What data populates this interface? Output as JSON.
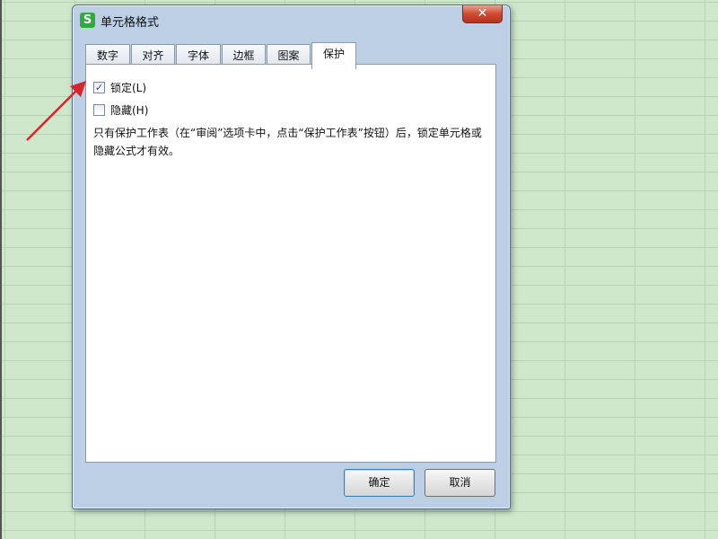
{
  "dialog": {
    "title": "单元格格式",
    "app_icon_letter": "S",
    "close_glyph": "✕",
    "tabs": [
      {
        "label": "数字"
      },
      {
        "label": "对齐"
      },
      {
        "label": "字体"
      },
      {
        "label": "边框"
      },
      {
        "label": "图案"
      },
      {
        "label": "保护"
      }
    ],
    "active_tab": "保护",
    "options": {
      "locked": {
        "label": "锁定(L)",
        "checked": true
      },
      "hidden": {
        "label": "隐藏(H)",
        "checked": false
      }
    },
    "help_text": "只有保护工作表（在“审阅”选项卡中，点击“保护工作表”按钮）后，锁定单元格或隐藏公式才有效。",
    "buttons": {
      "ok": "确定",
      "cancel": "取消"
    }
  },
  "colors": {
    "annotation_arrow": "#d7262b",
    "sheet_background": "#cfe8cc",
    "app_icon": "#2eab3b",
    "close_button": "#cf4a32"
  }
}
